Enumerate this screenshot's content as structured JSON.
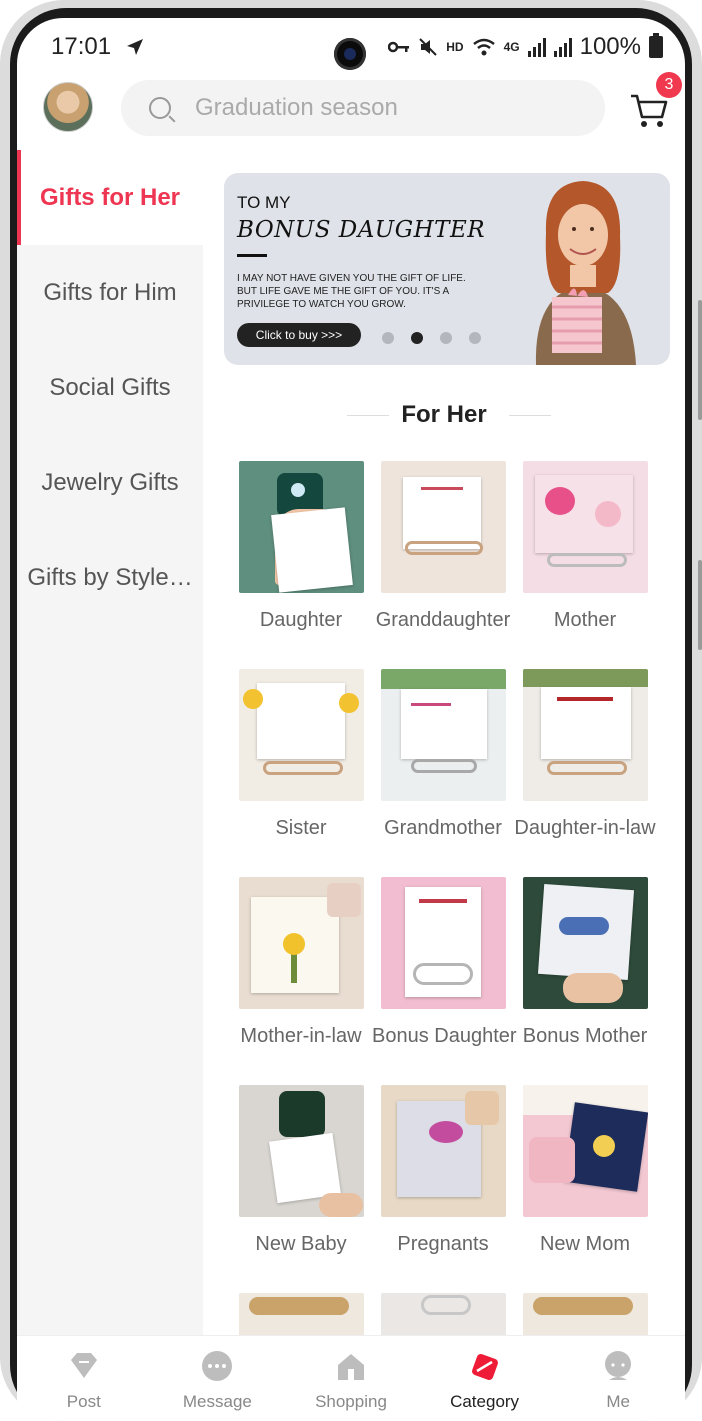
{
  "status_bar": {
    "time": "17:01",
    "battery": "100%",
    "network": "4G"
  },
  "header": {
    "search_placeholder": "Graduation season",
    "cart_count": "3"
  },
  "sidebar": {
    "items": [
      {
        "label": "Gifts for Her",
        "active": true
      },
      {
        "label": "Gifts for Him",
        "active": false
      },
      {
        "label": "Social Gifts",
        "active": false
      },
      {
        "label": "Jewelry Gifts",
        "active": false
      },
      {
        "label": "Gifts by Style…",
        "active": false
      }
    ]
  },
  "banner": {
    "to": "TO MY",
    "title": "BONUS DAUGHTER",
    "text": "I MAY NOT HAVE GIVEN YOU THE GIFT OF LIFE. BUT LIFE GAVE ME THE GIFT OF YOU. IT'S A PRIVILEGE TO WATCH YOU GROW.",
    "button": "Click to buy >>>",
    "active_dot": 2,
    "dot_count": 4
  },
  "section": {
    "title": "For Her"
  },
  "categories": [
    {
      "label": "Daughter"
    },
    {
      "label": "Granddaughter"
    },
    {
      "label": "Mother"
    },
    {
      "label": "Sister"
    },
    {
      "label": "Grandmother"
    },
    {
      "label": "Daughter-in-law"
    },
    {
      "label": "Mother-in-law"
    },
    {
      "label": "Bonus Daughter"
    },
    {
      "label": "Bonus Mother"
    },
    {
      "label": "New Baby"
    },
    {
      "label": "Pregnants"
    },
    {
      "label": "New Mom"
    }
  ],
  "bottom_nav": [
    {
      "label": "Post",
      "icon": "diamond-icon",
      "active": false
    },
    {
      "label": "Message",
      "icon": "chat-bubble-icon",
      "active": false
    },
    {
      "label": "Shopping",
      "icon": "house-icon",
      "active": false
    },
    {
      "label": "Category",
      "icon": "category-icon",
      "active": true
    },
    {
      "label": "Me",
      "icon": "person-icon",
      "active": false
    }
  ],
  "colors": {
    "accent": "#ee3552",
    "sidebar_bg": "#f5f5f6",
    "badge": "#f0384f"
  }
}
